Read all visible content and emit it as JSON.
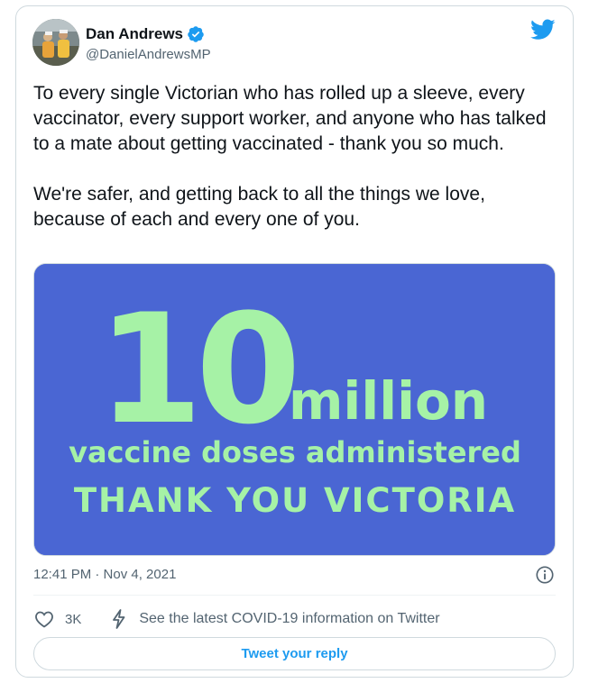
{
  "author": {
    "name": "Dan Andrews",
    "handle": "@DanielAndrewsMP",
    "avatar_icon": "profile-photo",
    "verified_icon": "verified-badge-icon"
  },
  "tweet": {
    "text": "To every single Victorian who has rolled up a sleeve, every vaccinator, every support worker, and anyone who has talked to a mate about getting vaccinated - thank you so much.\n\nWe're safer, and getting back to all the things we love, because of each and every one of you."
  },
  "media": {
    "big_number": "10",
    "unit": "million",
    "subtitle": "vaccine doses administered",
    "thanks": "THANK YOU VICTORIA",
    "background_color": "#4a66d3",
    "text_color": "#a6f2a6"
  },
  "meta": {
    "timestamp": "12:41 PM · Nov 4, 2021"
  },
  "actions": {
    "like_count": "3K",
    "covid_info": "See the latest COVID-19 information on Twitter",
    "reply_label": "Tweet your reply"
  },
  "colors": {
    "accent": "#1d9bf0",
    "secondary_text": "#536471",
    "border": "#cfd9de"
  }
}
